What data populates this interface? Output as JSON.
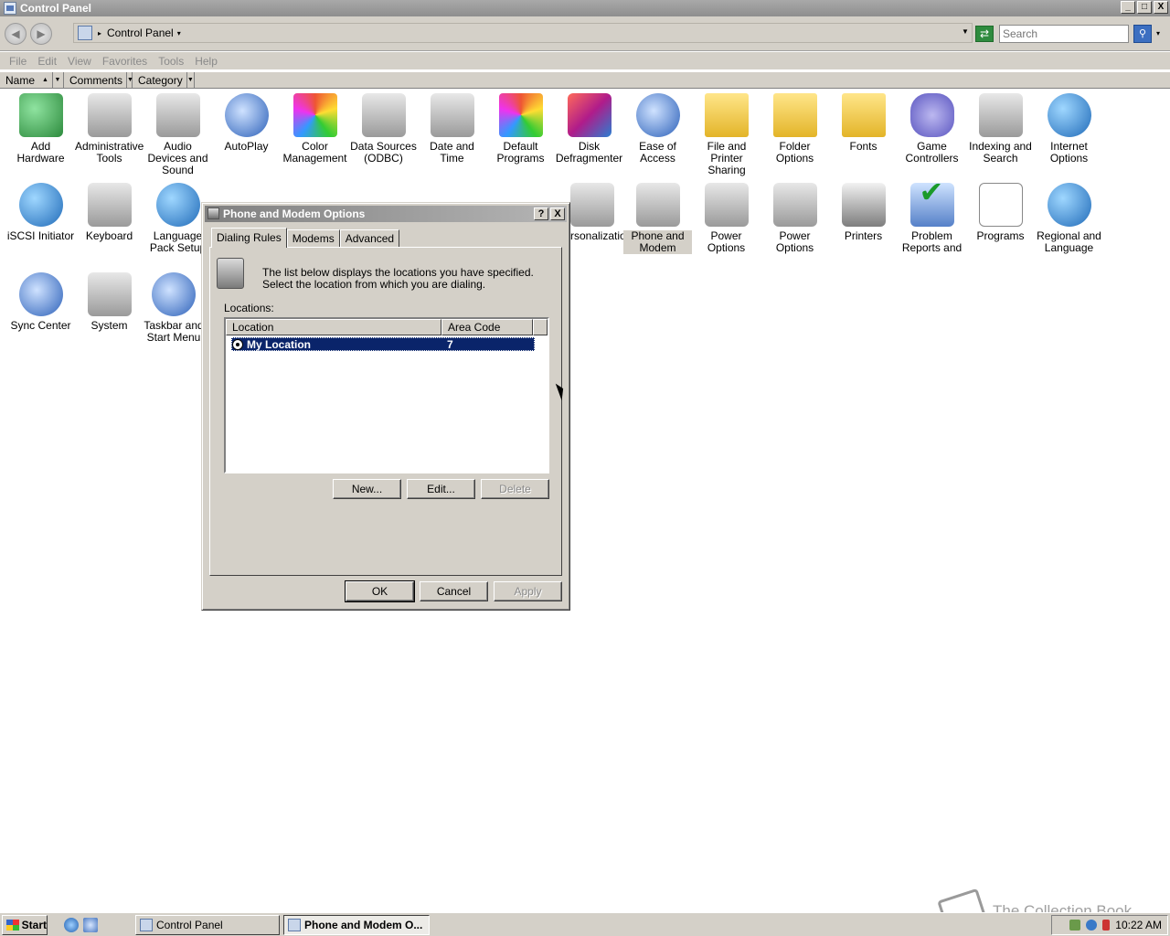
{
  "window": {
    "title": "Control Panel",
    "controls": {
      "minimize": "_",
      "maximize": "□",
      "close": "X"
    }
  },
  "address_bar": {
    "path": "Control Panel",
    "search_placeholder": "Search"
  },
  "menu": [
    "File",
    "Edit",
    "View",
    "Favorites",
    "Tools",
    "Help"
  ],
  "columns": [
    "Name",
    "Comments",
    "Category"
  ],
  "items": [
    {
      "label": "Add Hardware",
      "icon": "add-hardware-icon",
      "style": "green"
    },
    {
      "label": "Administrative Tools",
      "icon": "administrative-tools-icon",
      "style": "gray"
    },
    {
      "label": "Audio Devices and Sound",
      "icon": "speaker-icon",
      "style": "gray"
    },
    {
      "label": "AutoPlay",
      "icon": "autoplay-icon",
      "style": "blue"
    },
    {
      "label": "Color Management",
      "icon": "color-management-icon",
      "style": "color"
    },
    {
      "label": "Data Sources (ODBC)",
      "icon": "data-sources-icon",
      "style": "gray"
    },
    {
      "label": "Date and Time",
      "icon": "calendar-clock-icon",
      "style": "gray"
    },
    {
      "label": "Default Programs",
      "icon": "default-programs-icon",
      "style": "color"
    },
    {
      "label": "Disk Defragmenter",
      "icon": "defragmenter-icon",
      "style": "red"
    },
    {
      "label": "Ease of Access",
      "icon": "ease-of-access-icon",
      "style": "blue"
    },
    {
      "label": "File and Printer Sharing",
      "icon": "sharing-folder-icon",
      "style": "folder"
    },
    {
      "label": "Folder Options",
      "icon": "folder-options-icon",
      "style": "folder"
    },
    {
      "label": "Fonts",
      "icon": "fonts-folder-icon",
      "style": "folder"
    },
    {
      "label": "Game Controllers",
      "icon": "gamepad-icon",
      "style": "pad"
    },
    {
      "label": "Indexing and Search",
      "icon": "indexing-icon",
      "style": "gray"
    },
    {
      "label": "Internet Options",
      "icon": "internet-options-icon",
      "style": "globe"
    },
    {
      "label": "iSCSI Initiator",
      "icon": "iscsi-globe-icon",
      "style": "globe"
    },
    {
      "label": "Keyboard",
      "icon": "keyboard-icon",
      "style": "gray"
    },
    {
      "label": "Language Pack Setup",
      "icon": "language-globe-icon",
      "style": "globe"
    },
    {
      "label": "Phone and Modem",
      "icon": "phone-modem-icon",
      "style": "gray",
      "selected": true
    },
    {
      "label": "Power Options",
      "icon": "power-options-icon",
      "style": "gray"
    },
    {
      "label": "Power Options",
      "icon": "power-plug-icon",
      "style": "gray"
    },
    {
      "label": "Printers",
      "icon": "printer-icon",
      "style": "printer"
    },
    {
      "label": "Problem Reports and",
      "icon": "problem-reports-icon",
      "style": "check"
    },
    {
      "label": "Programs",
      "icon": "programs-icon",
      "style": "paper"
    },
    {
      "label": "Regional and Language",
      "icon": "regional-globe-icon",
      "style": "globe"
    },
    {
      "label": "Sync Center",
      "icon": "sync-icon",
      "style": "blue"
    },
    {
      "label": "System",
      "icon": "system-icon",
      "style": "gray"
    },
    {
      "label": "Taskbar and Start Menu",
      "icon": "taskbar-icon",
      "style": "blue"
    }
  ],
  "partial_label": "rsonalization",
  "dialog": {
    "title": "Phone and Modem Options",
    "help": "?",
    "close": "X",
    "tabs": [
      "Dialing Rules",
      "Modems",
      "Advanced"
    ],
    "intro": "The list below displays the locations you have specified. Select the location from which you are dialing.",
    "locations_label": "Locations:",
    "list_headers": {
      "location": "Location",
      "area_code": "Area Code"
    },
    "rows": [
      {
        "location": "My Location",
        "area_code": "7"
      }
    ],
    "buttons": {
      "new": "New...",
      "edit": "Edit...",
      "delete": "Delete",
      "ok": "OK",
      "cancel": "Cancel",
      "apply": "Apply"
    }
  },
  "taskbar": {
    "start": "Start",
    "tasks": [
      "Control Panel",
      "Phone and Modem O..."
    ],
    "clock": "10:22 AM"
  },
  "watermark": "The Collection Book"
}
